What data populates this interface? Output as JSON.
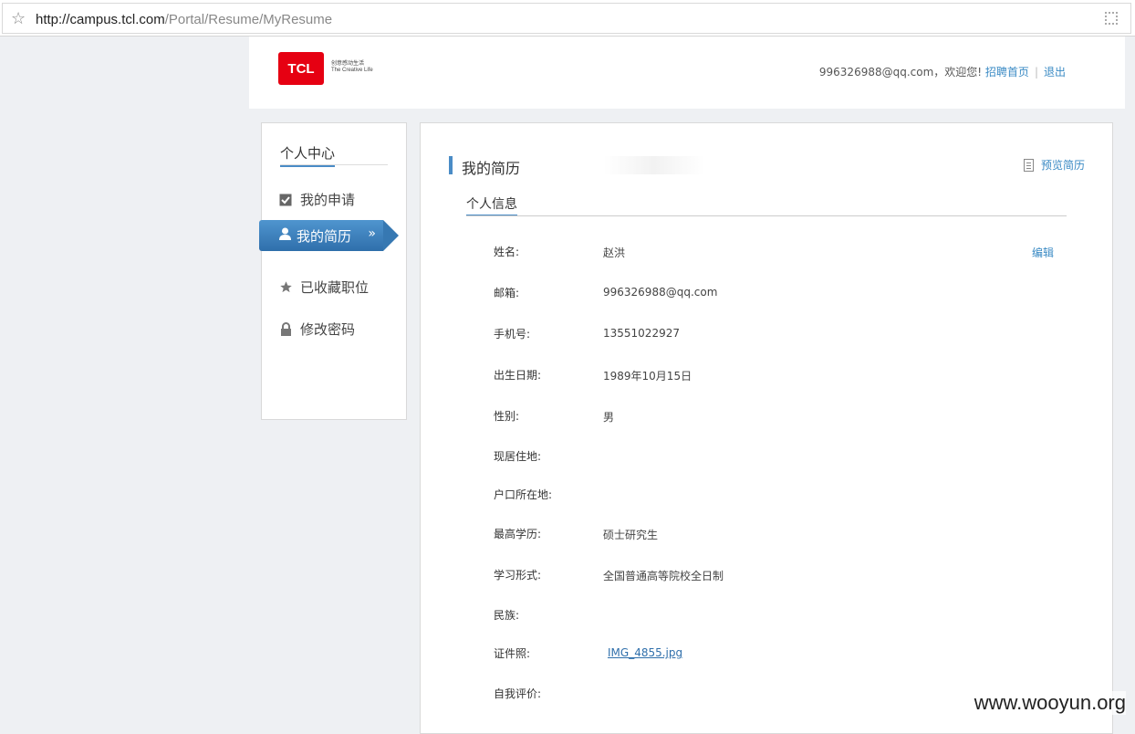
{
  "browser": {
    "url_host": "http://campus.tcl.com",
    "url_path": "/Portal/Resume/MyResume"
  },
  "header": {
    "logo_text": "TCL",
    "slogan_cn": "创意感动生活",
    "slogan_en": "The Creative Life",
    "user_email": "996326988@qq.com",
    "welcome": "，欢迎您!",
    "home_link": "招聘首页",
    "separator": "|",
    "logout_link": "退出"
  },
  "sidebar": {
    "title": "个人中心",
    "items": [
      {
        "label": "我的申请",
        "icon": "checkbox-icon"
      },
      {
        "label": "我的简历",
        "icon": "user-icon",
        "active": true
      },
      {
        "label": "已收藏职位",
        "icon": "star-icon"
      },
      {
        "label": "修改密码",
        "icon": "lock-icon"
      }
    ],
    "active_chevron": "»"
  },
  "main": {
    "title": "我的简历",
    "preview_label": "预览简历",
    "section_title": "个人信息",
    "edit_label": "编辑",
    "fields": [
      {
        "label": "姓名:",
        "value": "赵洪"
      },
      {
        "label": "邮箱:",
        "value": "996326988@qq.com"
      },
      {
        "label": "手机号:",
        "value": "13551022927"
      },
      {
        "label": "出生日期:",
        "value": "1989年10月15日"
      },
      {
        "label": "性别:",
        "value": "男"
      },
      {
        "label": "现居住地:",
        "value": ""
      },
      {
        "label": "户口所在地:",
        "value": ""
      },
      {
        "label": "最高学历:",
        "value": "硕士研究生"
      },
      {
        "label": "学习形式:",
        "value": "全国普通高等院校全日制"
      },
      {
        "label": "民族:",
        "value": ""
      },
      {
        "label": "证件照:",
        "value": "IMG_4855.jpg"
      },
      {
        "label": "自我评价:",
        "value": ""
      }
    ]
  },
  "watermark": "www.wooyun.org",
  "colors": {
    "accent": "#4a8cc6",
    "link": "#3a8ac4",
    "brand_red": "#e60012"
  }
}
